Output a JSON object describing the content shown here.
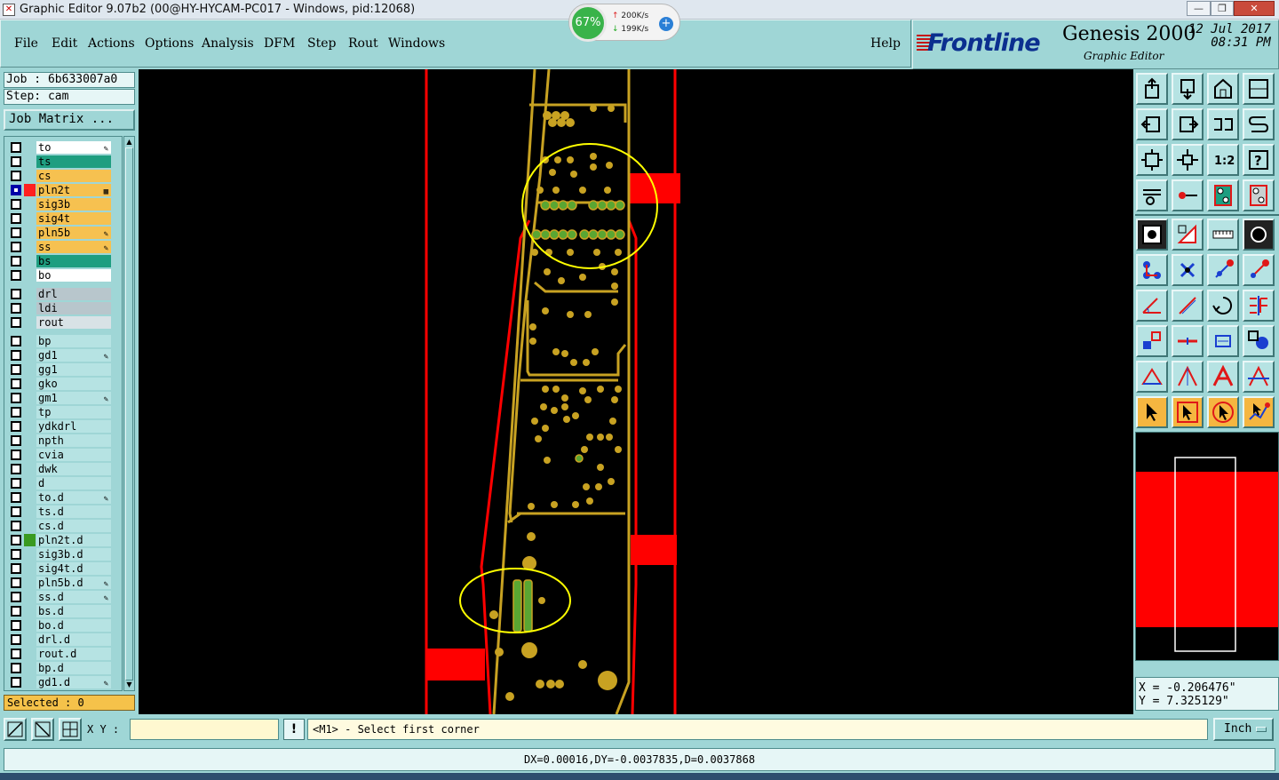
{
  "window": {
    "title": "Graphic Editor 9.07b2 (00@HY-HYCAM-PC017 - Windows, pid:12068)",
    "app_icon": "x-app-icon"
  },
  "net_widget": {
    "percent": "67%",
    "up": "200K/s",
    "down": "199K/s"
  },
  "menu": {
    "file": "File",
    "edit": "Edit",
    "actions": "Actions",
    "options": "Options",
    "analysis": "Analysis",
    "dfm": "DFM",
    "step": "Step",
    "rout": "Rout",
    "windows": "Windows",
    "help": "Help"
  },
  "brand": {
    "logo": "Frontline",
    "product": "Genesis 2000",
    "subtitle": "Graphic Editor",
    "date": "12 Jul 2017",
    "time": "08:31 PM"
  },
  "job": {
    "job_label": "Job : 6b633007a0",
    "step_label": "Step: cam",
    "job_matrix": "Job Matrix ..."
  },
  "layers": [
    {
      "name": "to",
      "color": "#ffffff",
      "flag": "pen"
    },
    {
      "name": "ts",
      "color": "#1e9e80",
      "flag": ""
    },
    {
      "name": "cs",
      "color": "#f6c150",
      "flag": ""
    },
    {
      "name": "pln2t",
      "color": "#f6c150",
      "flag": "grid",
      "active": true,
      "swatch": "#ff2020"
    },
    {
      "name": "sig3b",
      "color": "#f6c150",
      "flag": ""
    },
    {
      "name": "sig4t",
      "color": "#f6c150",
      "flag": ""
    },
    {
      "name": "pln5b",
      "color": "#f6c150",
      "flag": "pen"
    },
    {
      "name": "ss",
      "color": "#f6c150",
      "flag": "pen"
    },
    {
      "name": "bs",
      "color": "#1e9e80",
      "flag": ""
    },
    {
      "name": "bo",
      "color": "#ffffff",
      "flag": ""
    },
    {
      "name": "drl",
      "color": "#b8c6cc",
      "flag": "",
      "gap": true
    },
    {
      "name": "ldi",
      "color": "#b8c6cc",
      "flag": ""
    },
    {
      "name": "rout",
      "color": "#d8e2e6",
      "flag": ""
    },
    {
      "name": "bp",
      "color": "#b6e3e3",
      "flag": "",
      "gap": true
    },
    {
      "name": "gd1",
      "color": "#b6e3e3",
      "flag": "pen"
    },
    {
      "name": "gg1",
      "color": "#b6e3e3",
      "flag": ""
    },
    {
      "name": "gko",
      "color": "#b6e3e3",
      "flag": ""
    },
    {
      "name": "gm1",
      "color": "#b6e3e3",
      "flag": "pen"
    },
    {
      "name": "tp",
      "color": "#b6e3e3",
      "flag": ""
    },
    {
      "name": "ydkdrl",
      "color": "#b6e3e3",
      "flag": ""
    },
    {
      "name": "npth",
      "color": "#b6e3e3",
      "flag": ""
    },
    {
      "name": "cvia",
      "color": "#b6e3e3",
      "flag": ""
    },
    {
      "name": "dwk",
      "color": "#b6e3e3",
      "flag": ""
    },
    {
      "name": "d",
      "color": "#b6e3e3",
      "flag": ""
    },
    {
      "name": "to.d",
      "color": "#b6e3e3",
      "flag": "pen"
    },
    {
      "name": "ts.d",
      "color": "#b6e3e3",
      "flag": ""
    },
    {
      "name": "cs.d",
      "color": "#b6e3e3",
      "flag": ""
    },
    {
      "name": "pln2t.d",
      "color": "#b6e3e3",
      "flag": "",
      "swatch": "#3a9a20"
    },
    {
      "name": "sig3b.d",
      "color": "#b6e3e3",
      "flag": ""
    },
    {
      "name": "sig4t.d",
      "color": "#b6e3e3",
      "flag": ""
    },
    {
      "name": "pln5b.d",
      "color": "#b6e3e3",
      "flag": "pen"
    },
    {
      "name": "ss.d",
      "color": "#b6e3e3",
      "flag": "pen"
    },
    {
      "name": "bs.d",
      "color": "#b6e3e3",
      "flag": ""
    },
    {
      "name": "bo.d",
      "color": "#b6e3e3",
      "flag": ""
    },
    {
      "name": "drl.d",
      "color": "#b6e3e3",
      "flag": ""
    },
    {
      "name": "rout.d",
      "color": "#b6e3e3",
      "flag": ""
    },
    {
      "name": "bp.d",
      "color": "#b6e3e3",
      "flag": ""
    },
    {
      "name": "gd1.d",
      "color": "#b6e3e3",
      "flag": "pen"
    }
  ],
  "selected": "Selected : 0",
  "coords": {
    "x": "X = -0.206476\"",
    "y": "Y = 7.325129\""
  },
  "xy": {
    "label": "X Y :",
    "value": ""
  },
  "prompt": "<M1> - Select first corner",
  "units": "Inch",
  "status": "DX=0.00016,DY=-0.0037835,D=0.0037868",
  "colors": {
    "pad": "#c8a222",
    "outline": "#ff0000",
    "highlight": "#ffff00",
    "green_pad": "#5aa632",
    "panel": "#9fd6d6"
  },
  "tools": [
    "zoom-home-icon",
    "zoom-out-icon",
    "zoom-house-icon",
    "zoom-window-icon",
    "pan-left-icon",
    "pan-right-icon",
    "flip-icon",
    "s-curve-icon",
    "fit-icon",
    "center-icon",
    "ratio-1-2-icon",
    "help-question-icon",
    "measure-tool-icon",
    "pin-icon",
    "layer-color-icon",
    "layer-red-icon",
    "snap-circle-icon",
    "shape-edit-icon",
    "ruler-icon",
    "pad-icon",
    "connect-icon",
    "cross-icon",
    "line-node-icon",
    "line-node-red-icon",
    "angle-icon",
    "slash-icon",
    "rotate-icon",
    "align-icon",
    "copy-shape-icon",
    "minus-icon",
    "resize-icon",
    "group-icon",
    "arc-a-icon",
    "arc-b-icon",
    "arc-c-icon",
    "arc-d-icon",
    "select-arrow-icon",
    "select-box-icon",
    "select-circle-icon",
    "select-node-icon"
  ]
}
